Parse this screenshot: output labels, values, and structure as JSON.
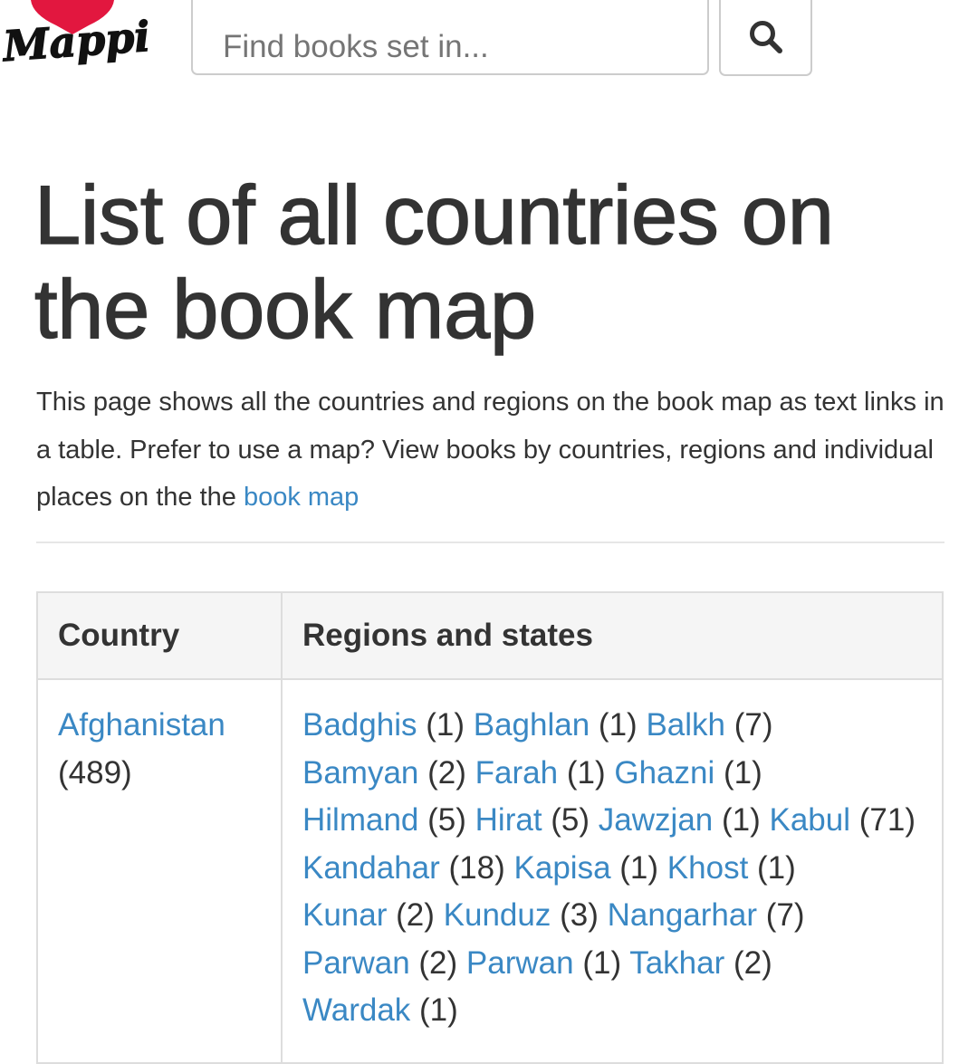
{
  "logo": {
    "text": "Mappit",
    "brand_color": "#e2173f"
  },
  "search": {
    "placeholder": "Find books set in...",
    "icon": "search-icon"
  },
  "page": {
    "title": "List of all countries on the book map",
    "intro_text": "This page shows all the countries and regions on the book map as text links in a table. Prefer to use a map? View books by countries, regions and individual places on the the ",
    "intro_link": "book map"
  },
  "table": {
    "headers": {
      "country": "Country",
      "regions": "Regions and states"
    },
    "rows": [
      {
        "country": "Afghanistan",
        "count": "(489)",
        "regions": [
          {
            "name": "Badghis",
            "count": "(1)"
          },
          {
            "name": "Baghlan",
            "count": "(1)"
          },
          {
            "name": "Balkh",
            "count": "(7)"
          },
          {
            "name": "Bamyan",
            "count": "(2)"
          },
          {
            "name": "Farah",
            "count": "(1)"
          },
          {
            "name": "Ghazni",
            "count": "(1)"
          },
          {
            "name": "Hilmand",
            "count": "(5)"
          },
          {
            "name": "Hirat",
            "count": "(5)"
          },
          {
            "name": "Jawzjan",
            "count": "(1)"
          },
          {
            "name": "Kabul",
            "count": "(71)"
          },
          {
            "name": "Kandahar",
            "count": "(18)"
          },
          {
            "name": "Kapisa",
            "count": "(1)"
          },
          {
            "name": "Khost",
            "count": "(1)"
          },
          {
            "name": "Kunar",
            "count": "(2)"
          },
          {
            "name": "Kunduz",
            "count": "(3)"
          },
          {
            "name": "Nangarhar",
            "count": "(7)"
          },
          {
            "name": "Parwan",
            "count": "(2)"
          },
          {
            "name": "Parwan",
            "count": "(1)"
          },
          {
            "name": "Takhar",
            "count": "(2)"
          },
          {
            "name": "Wardak",
            "count": "(1)"
          }
        ]
      }
    ]
  },
  "colors": {
    "link": "#3a88c4",
    "text": "#333333",
    "header_bg": "#f5f5f5",
    "border": "#dddddd"
  }
}
